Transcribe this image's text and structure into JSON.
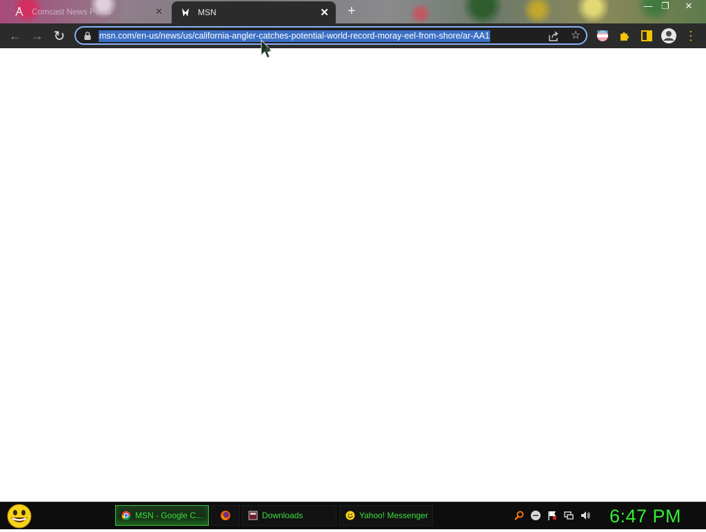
{
  "window": {
    "minimize_glyph": "—",
    "maximize_glyph": "❐",
    "close_glyph": "✕"
  },
  "tabs": [
    {
      "title": "Comcast News Portal",
      "active": false,
      "favicon": "comcast-icon"
    },
    {
      "title": "MSN",
      "active": true,
      "favicon": "msn-butterfly-icon"
    }
  ],
  "tab_close_glyph": "✕",
  "new_tab_glyph": "+",
  "toolbar": {
    "back_glyph": "←",
    "forward_glyph": "→",
    "reload_glyph": "↻",
    "url": "msn.com/en-us/news/us/california-angler-catches-potential-world-record-moray-eel-from-shore/ar-AA1",
    "star_glyph": "☆",
    "menu_glyph": "⋮"
  },
  "icons": {
    "lock": "lock-icon",
    "share": "share-icon",
    "star": "star-icon",
    "extensions": [
      "flag-extension-icon",
      "puzzle-extensions-icon",
      "side-panel-icon",
      "profile-avatar-icon",
      "kebab-menu-icon"
    ],
    "tray": [
      "search-tray-icon",
      "messenger-tray-icon",
      "flag-tray-icon",
      "network-tray-icon",
      "volume-tray-icon"
    ]
  },
  "taskbar": {
    "items": [
      {
        "label": "MSN - Google C...",
        "icon": "chrome-icon",
        "active": true
      },
      {
        "label": "",
        "icon": "firefox-icon",
        "active": false
      },
      {
        "label": "Downloads",
        "icon": "downloads-icon",
        "active": false
      },
      {
        "label": "Yahoo! Messenger",
        "icon": "yahoo-messenger-icon",
        "active": false
      }
    ],
    "clock": "6:47 PM"
  },
  "colors": {
    "toolbar_bg": "#2b2b2b",
    "omnibox_border": "#8ab4f8",
    "url_selection": "#3b6fc4",
    "taskbar_text": "#3fe03f",
    "clock": "#33ee33"
  }
}
